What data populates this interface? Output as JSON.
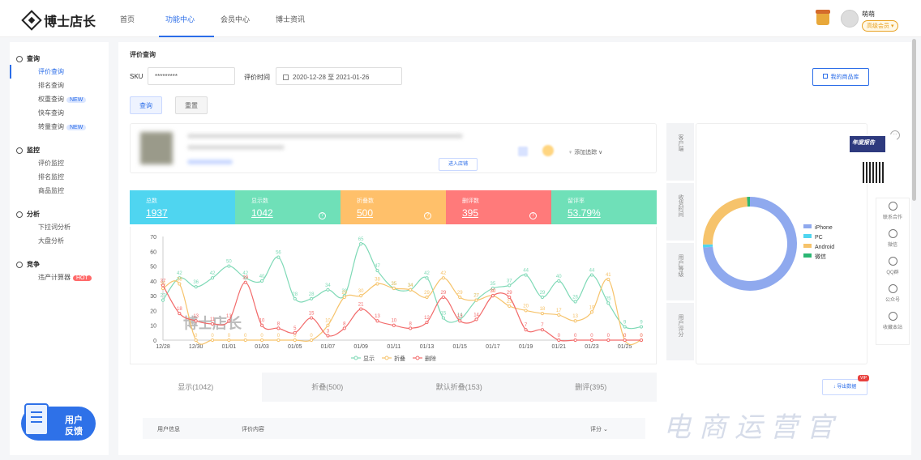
{
  "header": {
    "logo": "博士店长",
    "nav": [
      "首页",
      "功能中心",
      "会员中心",
      "博士资讯"
    ],
    "active_nav": 1,
    "user_name": "萌萌",
    "user_badge": "高级会员 ▾"
  },
  "sidebar": {
    "groups": [
      {
        "label": "查询",
        "icon": "search-icon",
        "items": [
          {
            "label": "评价查询",
            "active": true
          },
          {
            "label": "排名查询"
          },
          {
            "label": "权重查询",
            "tag": "NEW"
          },
          {
            "label": "快车查询"
          },
          {
            "label": "转量查询",
            "tag": "NEW"
          }
        ]
      },
      {
        "label": "监控",
        "icon": "monitor-icon",
        "items": [
          {
            "label": "评价监控"
          },
          {
            "label": "排名监控"
          },
          {
            "label": "商品监控"
          }
        ]
      },
      {
        "label": "分析",
        "icon": "analysis-icon",
        "items": [
          {
            "label": "下拉词分析"
          },
          {
            "label": "大盘分析"
          }
        ]
      },
      {
        "label": "竞争",
        "icon": "compete-icon",
        "items": [
          {
            "label": "违产计算器",
            "tag": "HOT"
          }
        ]
      }
    ],
    "feedback": [
      "用户",
      "反馈"
    ]
  },
  "query": {
    "title": "评价查询",
    "sku_label": "SKU",
    "sku_value": "*********",
    "time_label": "评价时间",
    "date_from": "2020-12-28",
    "date_to": "2021-01-26",
    "date_sep": "至",
    "search_btn": "查询",
    "reset_btn": "重置",
    "lib_btn": "我的商品库"
  },
  "product": {
    "shop_btn": "进入店铺",
    "track": "添加追踪 ∨"
  },
  "stats": [
    {
      "label": "总数",
      "value": "1937",
      "color": "#4fd5f0"
    },
    {
      "label": "显示数",
      "value": "1042",
      "color": "#6fe0b8"
    },
    {
      "label": "折叠数",
      "value": "500",
      "color": "#ffc06a"
    },
    {
      "label": "删评数",
      "value": "395",
      "color": "#ff7a7a"
    },
    {
      "label": "留评率",
      "value": "53.79%",
      "color": "#6fe0b8"
    }
  ],
  "side_tabs": [
    "客户端",
    "收货时间",
    "用户等级",
    "用户评分"
  ],
  "chart_data": [
    {
      "type": "line",
      "x": [
        "12/28",
        "12/29",
        "12/30",
        "12/31",
        "01/01",
        "01/02",
        "01/03",
        "01/04",
        "01/05",
        "01/06",
        "01/07",
        "01/08",
        "01/09",
        "01/10",
        "01/11",
        "01/12",
        "01/13",
        "01/14",
        "01/15",
        "01/16",
        "01/17",
        "01/18",
        "01/19",
        "01/20",
        "01/21",
        "01/22",
        "01/23",
        "01/24",
        "01/25",
        "01/26"
      ],
      "xticks": [
        "12/28",
        "12/30",
        "01/01",
        "01/03",
        "01/05",
        "01/07",
        "01/09",
        "01/11",
        "01/13",
        "01/15",
        "01/17",
        "01/19",
        "01/21",
        "01/23",
        "01/25"
      ],
      "ylim": [
        0,
        70
      ],
      "yticks": [
        0,
        10,
        20,
        30,
        40,
        50,
        60,
        70
      ],
      "series": [
        {
          "name": "显示",
          "color": "#7ed9b6",
          "values": [
            27,
            42,
            36,
            42,
            50,
            42,
            40,
            56,
            28,
            28,
            34,
            30,
            65,
            47,
            35,
            34,
            42,
            15,
            14,
            27,
            35,
            37,
            44,
            29,
            40,
            26,
            44,
            25,
            9,
            9
          ]
        },
        {
          "name": "折叠",
          "color": "#f6c36b",
          "values": [
            35,
            38,
            0,
            0,
            0,
            0,
            0,
            0,
            0,
            0,
            10,
            29,
            30,
            38,
            35,
            34,
            29,
            42,
            29,
            27,
            30,
            23,
            20,
            18,
            17,
            13,
            19,
            41,
            0,
            0
          ]
        },
        {
          "name": "删除",
          "color": "#f26a6a",
          "values": [
            37,
            18,
            13,
            11,
            13,
            39,
            10,
            8,
            5,
            15,
            3,
            8,
            21,
            13,
            10,
            8,
            12,
            29,
            13,
            14,
            30,
            29,
            7,
            7,
            0,
            0,
            0,
            0,
            0,
            0
          ]
        }
      ],
      "watermark": "博士店长"
    },
    {
      "type": "pie",
      "categories": [
        "iPhone",
        "PC",
        "Android",
        "微信"
      ],
      "values": [
        73,
        1,
        24,
        1
      ],
      "colors": [
        "#8fa9ee",
        "#4fd5f0",
        "#f6c36b",
        "#2bb673"
      ]
    }
  ],
  "review_tabs": [
    "显示(1042)",
    "折叠(500)",
    "默认折叠(153)",
    "删评(395)"
  ],
  "export": {
    "label": "导出数据",
    "vip": "VIP"
  },
  "table": {
    "headers": [
      "用户信息",
      "评价内容",
      "评分"
    ]
  },
  "right_rail": [
    "联系合作",
    "微信",
    "QQ群",
    "公众号",
    "收藏本站"
  ],
  "promo": {
    "title": "年度报告"
  },
  "watermark": "电商运营官"
}
